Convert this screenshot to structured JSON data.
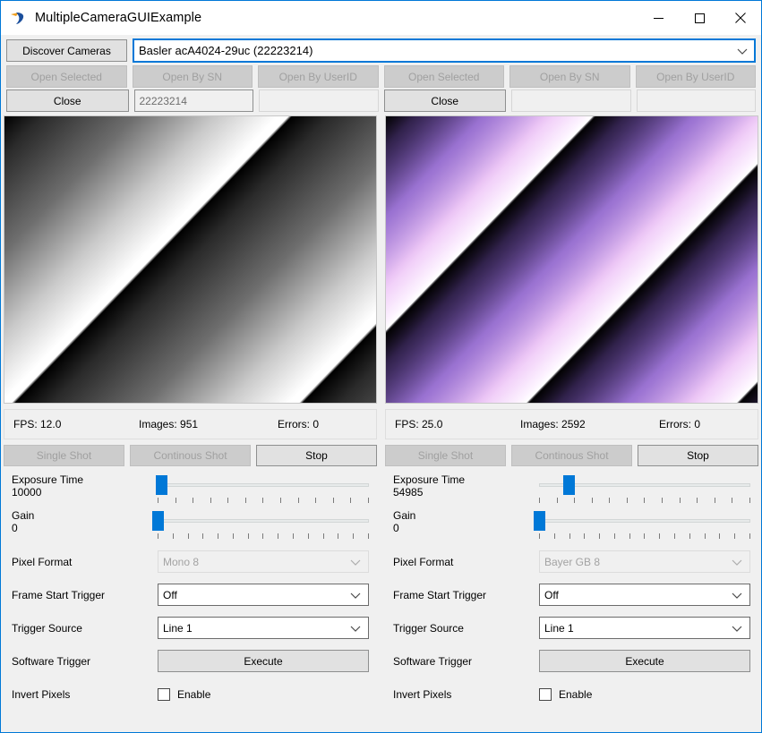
{
  "window": {
    "title": "MultipleCameraGUIExample",
    "icon": "basler-logo-icon",
    "accent_color": "#0078d7",
    "background_color": "#f0f0f0",
    "caption": {
      "minimize": "minimize-icon",
      "maximize": "maximize-icon",
      "close": "close-icon"
    }
  },
  "top": {
    "discover_label": "Discover Cameras",
    "camera_combo": {
      "value": "Basler acA4024-29uc (22223214)",
      "placeholder": ""
    }
  },
  "cameras": [
    {
      "id": "left",
      "open_selected_label": "Open Selected",
      "open_by_sn_label": "Open By SN",
      "open_by_userid_label": "Open By UserID",
      "close_label": "Close",
      "sn_value": "22223214",
      "sn_placeholder": "",
      "userid_value": "",
      "userid_placeholder": "",
      "image_kind": "mono-gradient",
      "status": {
        "fps": "FPS: 12.0",
        "images": "Images: 951",
        "errors": "Errors: 0"
      },
      "single_shot_label": "Single Shot",
      "continuous_shot_label": "Continous Shot",
      "stop_label": "Stop",
      "exposure": {
        "label": "Exposure Time",
        "value": "10000",
        "percent": 2,
        "ticks": 13
      },
      "gain": {
        "label": "Gain",
        "value": "0",
        "percent": 0,
        "ticks": 15
      },
      "pixel_format": {
        "label": "Pixel Format",
        "value": "Mono 8",
        "disabled": true
      },
      "frame_start_trigger": {
        "label": "Frame Start Trigger",
        "value": "Off",
        "disabled": false
      },
      "trigger_source": {
        "label": "Trigger Source",
        "value": "Line 1",
        "disabled": false
      },
      "software_trigger": {
        "label": "Software Trigger",
        "button": "Execute"
      },
      "invert_pixels": {
        "label": "Invert Pixels",
        "checkbox_label": "Enable",
        "checked": false
      }
    },
    {
      "id": "right",
      "open_selected_label": "Open Selected",
      "open_by_sn_label": "Open By SN",
      "open_by_userid_label": "Open By UserID",
      "close_label": "Close",
      "sn_value": "",
      "sn_placeholder": "",
      "userid_value": "",
      "userid_placeholder": "",
      "image_kind": "color-gradient",
      "status": {
        "fps": "FPS: 25.0",
        "images": "Images: 2592",
        "errors": "Errors: 0"
      },
      "single_shot_label": "Single Shot",
      "continuous_shot_label": "Continous Shot",
      "stop_label": "Stop",
      "exposure": {
        "label": "Exposure Time",
        "value": "54985",
        "percent": 14,
        "ticks": 13
      },
      "gain": {
        "label": "Gain",
        "value": "0",
        "percent": 0,
        "ticks": 15
      },
      "pixel_format": {
        "label": "Pixel Format",
        "value": "Bayer GB 8",
        "disabled": true
      },
      "frame_start_trigger": {
        "label": "Frame Start Trigger",
        "value": "Off",
        "disabled": false
      },
      "trigger_source": {
        "label": "Trigger Source",
        "value": "Line 1",
        "disabled": false
      },
      "software_trigger": {
        "label": "Software Trigger",
        "button": "Execute"
      },
      "invert_pixels": {
        "label": "Invert Pixels",
        "checkbox_label": "Enable",
        "checked": false
      }
    }
  ]
}
